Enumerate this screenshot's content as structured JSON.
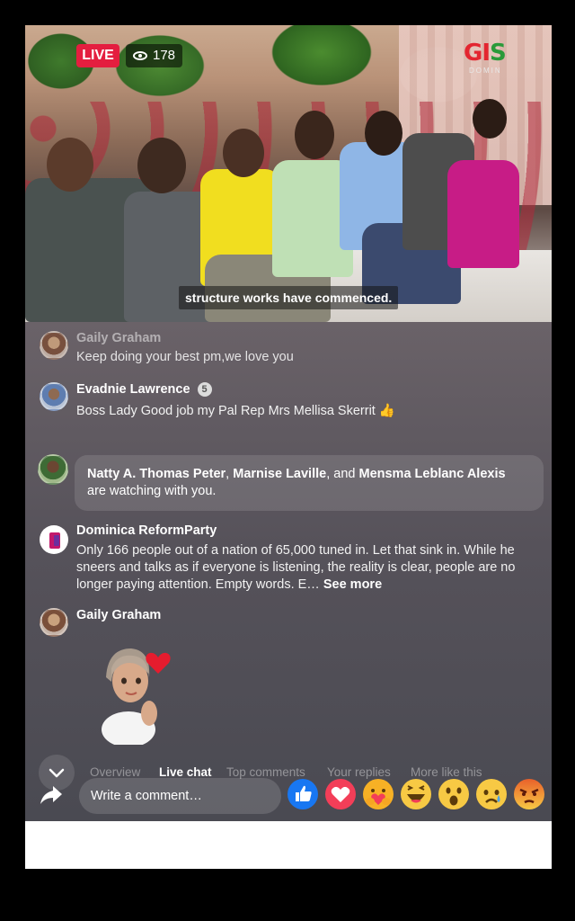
{
  "video": {
    "live_label": "LIVE",
    "viewer_count": "178",
    "logo_text_g": "GI",
    "logo_text_s": "S",
    "logo_sub": "DOMIN",
    "caption": "structure works have commenced."
  },
  "comments": [
    {
      "name": "Gaily Graham",
      "text": "Keep  doing your best pm,we love you"
    },
    {
      "name": "Evadnie Lawrence",
      "badge": "5",
      "text": "Boss Lady Good job my Pal Rep Mrs Mellisa Skerrit 👍"
    },
    {
      "name": "Dominica ReformParty",
      "text": "Only 166 people out of a nation of 65,000 tuned in. Let that sink in. While he sneers and talks as if everyone is listening, the reality is clear, people are no longer paying attention. Empty words. E…",
      "see_more": "See more"
    },
    {
      "name": "Gaily Graham",
      "text": ""
    }
  ],
  "watching": {
    "names": [
      "Natty A. Thomas Peter",
      "Marnise Laville",
      "Mensma Leblanc Alexis"
    ],
    "sep1": ", ",
    "sep2": ", and ",
    "suffix": "are watching with you."
  },
  "tabs": [
    "Overview",
    "Live chat",
    "Top comments",
    "Your replies",
    "More like this"
  ],
  "active_tab": "Live chat",
  "comment_placeholder": "Write a comment…",
  "reactions": [
    "like-icon",
    "love-icon",
    "care-icon",
    "haha-icon",
    "wow-icon",
    "sad-icon",
    "angry-icon"
  ],
  "colors": {
    "live": "#e41e3f",
    "like": "#1877f2",
    "love": "#f33e58"
  }
}
